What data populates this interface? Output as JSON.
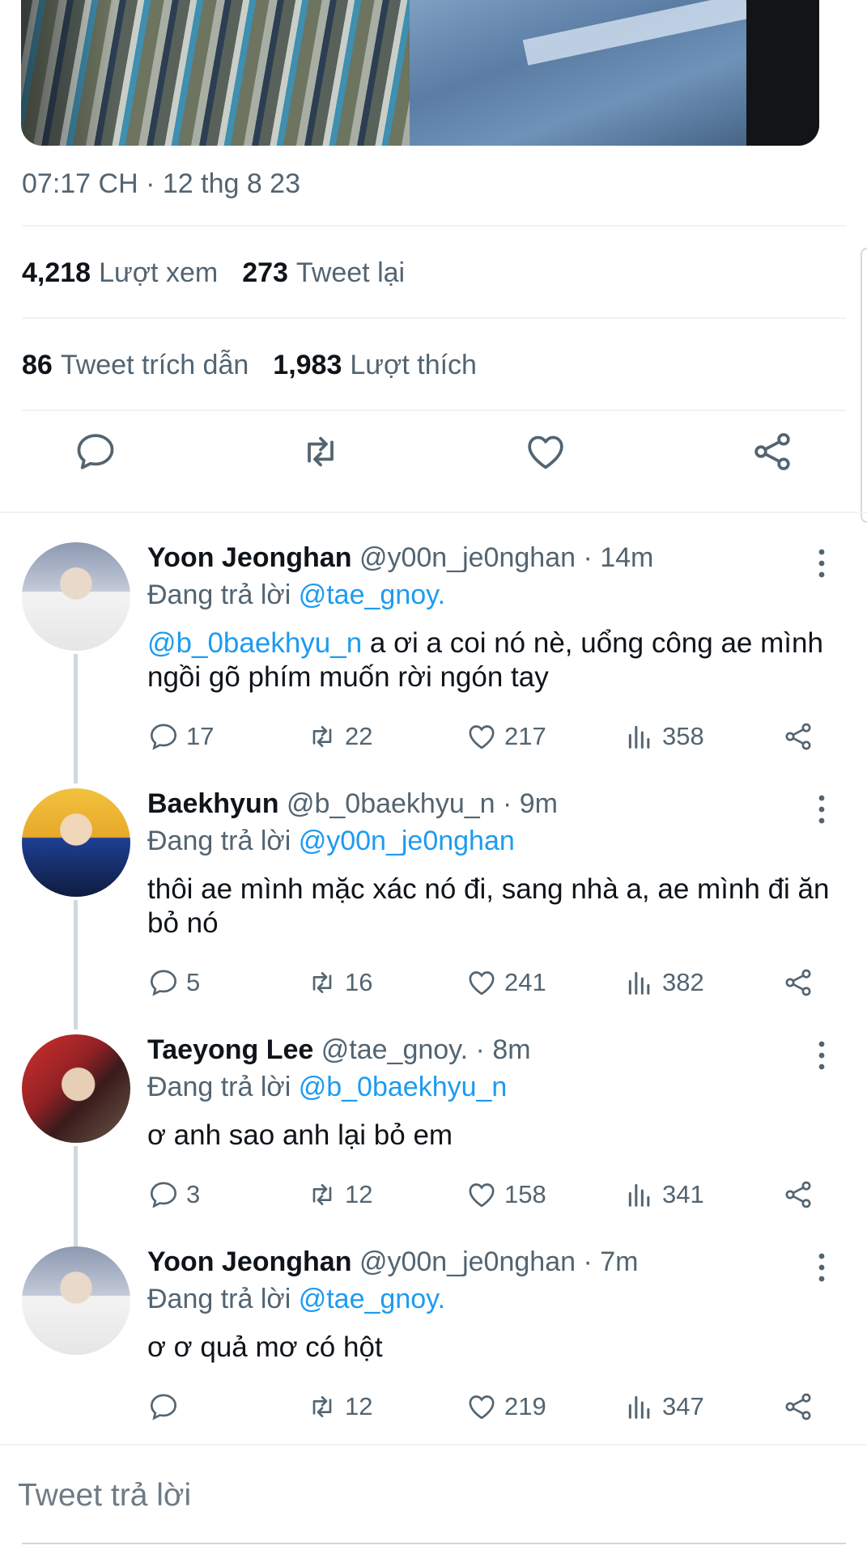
{
  "tweet": {
    "timestamp": "07:17 CH · 12 thg 8 23",
    "views_count": "4,218",
    "views_label": "Lượt xem",
    "retweets_count": "273",
    "retweets_label": "Tweet lại",
    "quotes_count": "86",
    "quotes_label": "Tweet trích dẫn",
    "likes_count": "1,983",
    "likes_label": "Lượt thích"
  },
  "replying_prefix": "Đang trả lời",
  "replies": [
    {
      "name": "Yoon Jeonghan",
      "handle": "@y00n_je0nghan · 14m",
      "replying_to": "@tae_gnoy.",
      "mention": "@b_0baekhyu_n",
      "text": " a ơi a coi nó nè, uổng công ae mình ngồi gõ phím muốn rời ngón tay",
      "replies": "17",
      "retweets": "22",
      "likes": "217",
      "views": "358"
    },
    {
      "name": "Baekhyun",
      "handle": "@b_0baekhyu_n · 9m",
      "replying_to": "@y00n_je0nghan",
      "mention": "",
      "text": "thôi ae mình mặc xác nó đi, sang nhà a, ae mình đi ăn bỏ nó",
      "replies": "5",
      "retweets": "16",
      "likes": "241",
      "views": "382"
    },
    {
      "name": "Taeyong Lee",
      "handle": "@tae_gnoy. · 8m",
      "replying_to": "@b_0baekhyu_n",
      "mention": "",
      "text": "ơ anh sao anh lại bỏ em",
      "replies": "3",
      "retweets": "12",
      "likes": "158",
      "views": "341"
    },
    {
      "name": "Yoon Jeonghan",
      "handle": "@y00n_je0nghan · 7m",
      "replying_to": "@tae_gnoy.",
      "mention": "",
      "text": "ơ ơ quả mơ có hột",
      "replies": "",
      "retweets": "12",
      "likes": "219",
      "views": "347"
    }
  ],
  "compose": {
    "placeholder": "Tweet trả lời"
  },
  "colors": {
    "accent": "#1d9bf0",
    "secondary_text": "#536471",
    "primary_text": "#0f1419"
  }
}
